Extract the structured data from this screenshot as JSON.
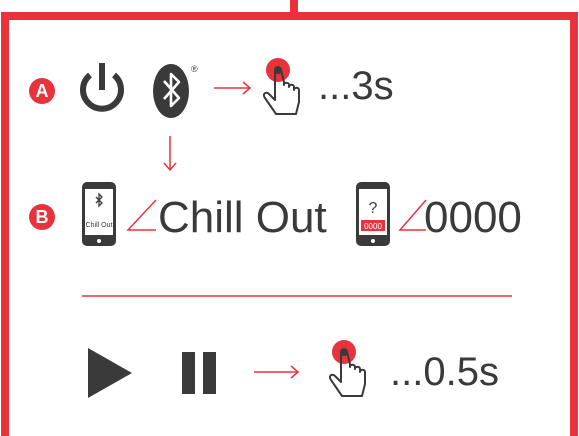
{
  "colors": {
    "frame": "#e8333c",
    "icon": "#3a3a3a",
    "accent": "#e8333c"
  },
  "step_a": {
    "badge": "A",
    "icons": [
      "power-icon",
      "bluetooth-icon",
      "arrow-right-icon",
      "tap-hand-icon"
    ],
    "hold_time": "...3s",
    "bluetooth_mark": "®"
  },
  "step_b": {
    "badge": "B",
    "device_name": "Chill Out",
    "phone_screen_label": "Chill Out",
    "pin_prompt_symbol": "?",
    "pin_screen_value": "0000",
    "pin_code": "0000"
  },
  "step_c": {
    "icons": [
      "play-icon",
      "pause-icon",
      "arrow-right-icon",
      "tap-hand-icon"
    ],
    "hold_time": "...0.5s"
  }
}
